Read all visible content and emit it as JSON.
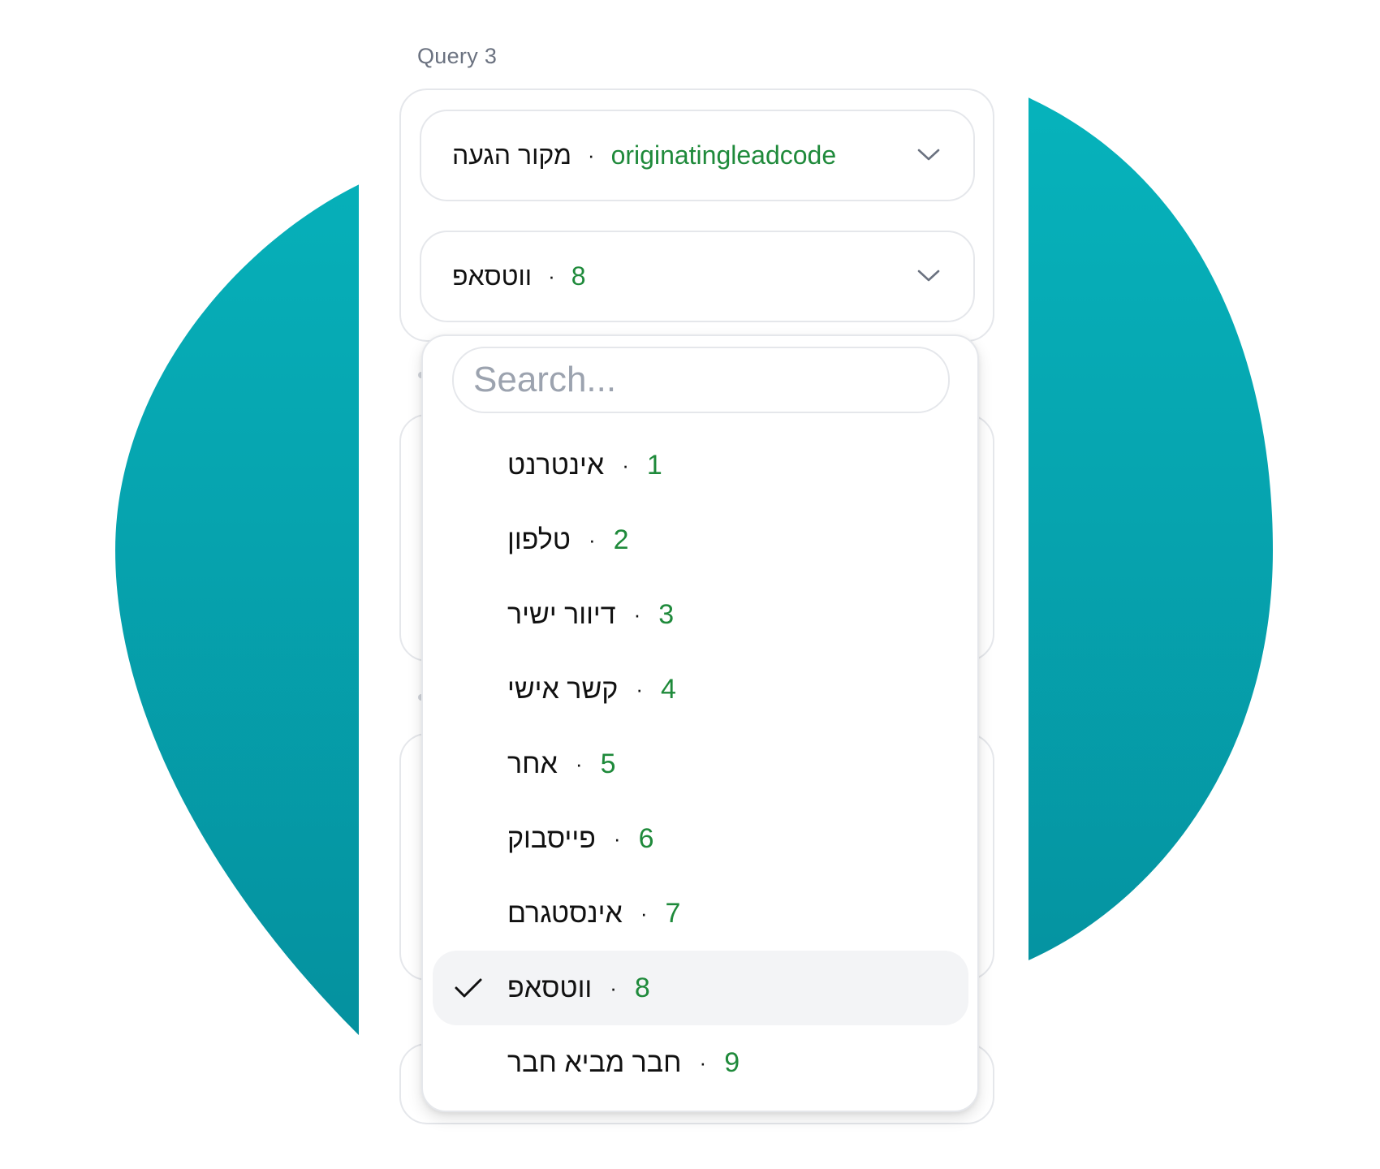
{
  "colors": {
    "teal_top": "#06b3bc",
    "teal_bottom": "#058f9d",
    "code_green": "#1f8a3b",
    "border": "#e5e7eb",
    "selected_bg": "#f3f4f6"
  },
  "query": {
    "label": "Query 3",
    "field_select": {
      "label": "מקור הגעה",
      "separator": "·",
      "code": "originatingleadcode",
      "icon": "chevron-down-icon"
    },
    "value_select": {
      "label": "ווטסאפ",
      "separator": "·",
      "code": "8",
      "icon": "chevron-down-icon"
    }
  },
  "dropdown": {
    "search": {
      "placeholder": "Search...",
      "value": ""
    },
    "options": [
      {
        "label": "אינטרנט",
        "separator": "·",
        "code": "1",
        "selected": false
      },
      {
        "label": "טלפון",
        "separator": "·",
        "code": "2",
        "selected": false
      },
      {
        "label": "דיוור ישיר",
        "separator": "·",
        "code": "3",
        "selected": false
      },
      {
        "label": "קשר אישי",
        "separator": "·",
        "code": "4",
        "selected": false
      },
      {
        "label": "אחר",
        "separator": "·",
        "code": "5",
        "selected": false
      },
      {
        "label": "פייסבוק",
        "separator": "·",
        "code": "6",
        "selected": false
      },
      {
        "label": "אינסטגרם",
        "separator": "·",
        "code": "7",
        "selected": false
      },
      {
        "label": "ווטסאפ",
        "separator": "·",
        "code": "8",
        "selected": true,
        "icon": "check-icon"
      },
      {
        "label": "חבר מביא חבר",
        "separator": "·",
        "code": "9",
        "selected": false
      }
    ]
  }
}
